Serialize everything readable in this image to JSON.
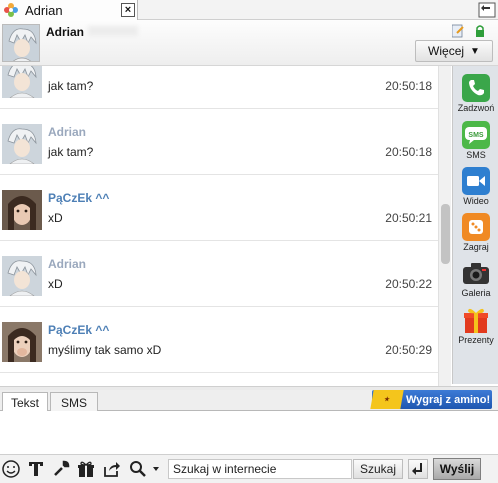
{
  "tab": {
    "title": "Adrian",
    "close_label": "×"
  },
  "header": {
    "contact_name": "Adrian",
    "more_label": "Więcej"
  },
  "messages": [
    {
      "author": "",
      "author_type": "a",
      "text": "jak tam?",
      "time": "20:50:18"
    },
    {
      "author": "Adrian",
      "author_type": "a",
      "text": "jak tam?",
      "time": "20:50:18"
    },
    {
      "author": "PąCzEk ^^",
      "author_type": "p",
      "text": "xD",
      "time": "20:50:21"
    },
    {
      "author": "Adrian",
      "author_type": "a",
      "text": "xD",
      "time": "20:50:22"
    },
    {
      "author": "PąCzEk ^^",
      "author_type": "p",
      "text": "myślimy tak samo xD",
      "time": "20:50:29"
    }
  ],
  "sidebar": {
    "items": [
      {
        "label": "Zadzwoń",
        "icon": "phone-icon",
        "color": "#3aa64a"
      },
      {
        "label": "SMS",
        "icon": "sms-icon",
        "color": "#4cb848"
      },
      {
        "label": "Wideo",
        "icon": "video-icon",
        "color": "#2e7fd0"
      },
      {
        "label": "Zagraj",
        "icon": "game-icon",
        "color": "#f08a24"
      },
      {
        "label": "Galeria",
        "icon": "camera-icon",
        "color": "#333333"
      },
      {
        "label": "Prezenty",
        "icon": "gift-icon",
        "color": "#e23a1e"
      }
    ]
  },
  "input_tabs": {
    "text_label": "Tekst",
    "sms_label": "SMS"
  },
  "promo": {
    "text": "Wygraj z amino!"
  },
  "toolbar": {
    "search_value": "Szukaj w internecie",
    "search_button": "Szukaj",
    "send_button": "Wyślij"
  }
}
